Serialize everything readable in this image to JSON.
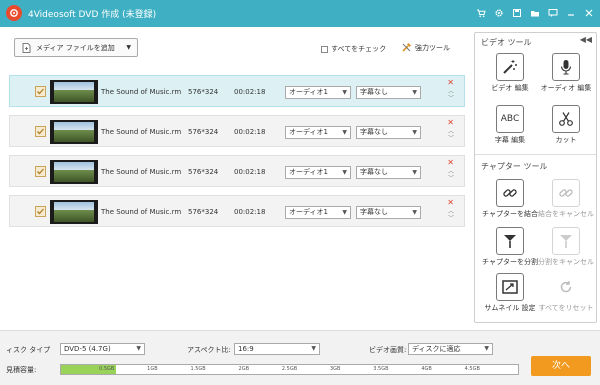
{
  "window": {
    "title": "4Videosoft DVD 作成 (未登録)",
    "title_icons": [
      "cart-icon",
      "gear-icon",
      "save-icon",
      "folder-icon",
      "feedback-icon",
      "minimize-icon",
      "close-icon"
    ]
  },
  "toolbar": {
    "add_media_label": "メディア ファイルを追加",
    "check_all_label": "すべてをチェック",
    "power_tool_label": "強力ツール"
  },
  "files": [
    {
      "name": "The Sound of Music.rm",
      "resolution": "576*324",
      "duration": "00:02:18",
      "audio": "オーディオ1",
      "subtitle": "字幕なし",
      "checked": true,
      "selected": true
    },
    {
      "name": "The Sound of Music.rm",
      "resolution": "576*324",
      "duration": "00:02:18",
      "audio": "オーディオ1",
      "subtitle": "字幕なし",
      "checked": true,
      "selected": false
    },
    {
      "name": "The Sound of Music.rm",
      "resolution": "576*324",
      "duration": "00:02:18",
      "audio": "オーディオ1",
      "subtitle": "字幕なし",
      "checked": true,
      "selected": false
    },
    {
      "name": "The Sound of Music.rm",
      "resolution": "576*324",
      "duration": "00:02:18",
      "audio": "オーディオ1",
      "subtitle": "字幕なし",
      "checked": true,
      "selected": false
    }
  ],
  "video_tools": {
    "heading": "ビデオ ツール",
    "items": [
      {
        "label": "ビデオ 編集",
        "icon": "magic-wand-icon"
      },
      {
        "label": "オーディオ 編集",
        "icon": "microphone-icon"
      },
      {
        "label": "字幕 編集",
        "icon": "abc-icon",
        "icon_text": "ABC"
      },
      {
        "label": "カット",
        "icon": "scissors-icon"
      }
    ]
  },
  "chapter_tools": {
    "heading": "チャプター ツール",
    "items": [
      {
        "label": "チャプターを結合",
        "icon": "link-icon",
        "enabled": true
      },
      {
        "label": "結合をキャンセル",
        "icon": "unlink-icon",
        "enabled": false
      },
      {
        "label": "チャプターを分割",
        "icon": "split-icon",
        "enabled": true
      },
      {
        "label": "分割をキャンセル",
        "icon": "unsplit-icon",
        "enabled": false
      },
      {
        "label": "サムネイル 設定",
        "icon": "thumbnail-icon",
        "enabled": true
      },
      {
        "label": "すべてをリセット",
        "icon": "reset-icon",
        "enabled": false
      }
    ]
  },
  "bottom": {
    "disc_type_label": "ィスク タイプ",
    "disc_type_value": "DVD-5 (4.7G)",
    "aspect_label": "アスペクト比:",
    "aspect_value": "16:9",
    "quality_label": "ビデオ画質:",
    "quality_value": "ディスクに適応",
    "capacity_label": "見積容量:",
    "capacity_used_gb": 0.6,
    "capacity_max_gb": 5,
    "capacity_ticks": [
      "0.5GB",
      "1GB",
      "1.5GB",
      "2GB",
      "2.5GB",
      "3GB",
      "3.5GB",
      "4GB",
      "4.5GB"
    ],
    "next_label": "次へ"
  },
  "colors": {
    "titlebar": "#3fb0c3",
    "next_button": "#f29a1f",
    "capacity_fill": "#9ad35a",
    "selected_row": "#ddf1f5"
  }
}
